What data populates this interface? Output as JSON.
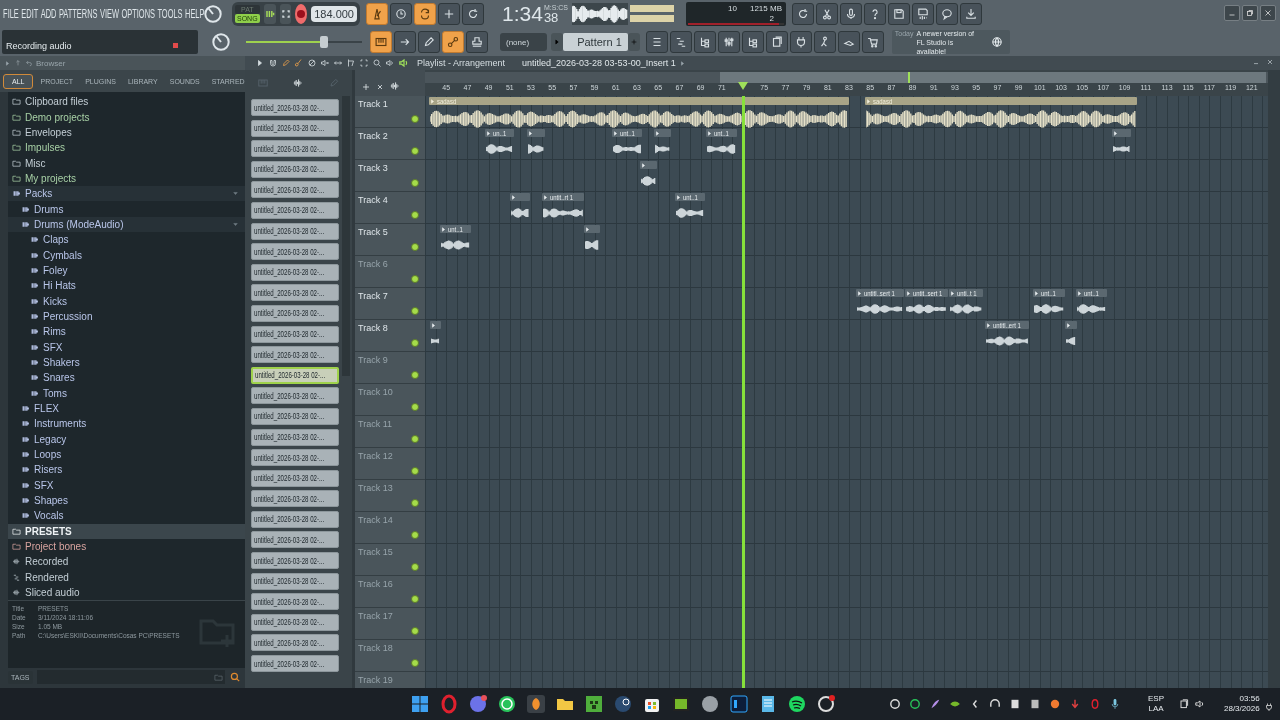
{
  "menu": [
    "FILE",
    "EDIT",
    "ADD",
    "PATTERNS",
    "VIEW",
    "OPTIONS",
    "TOOLS",
    "HELP"
  ],
  "hint": "Recording audio",
  "transport": {
    "modes": [
      {
        "label": "PAT",
        "selected": false
      },
      {
        "label": "SONG",
        "selected": true
      }
    ],
    "recording": true,
    "tempo": "184.000",
    "master": {
      "level": 0.67
    }
  },
  "toggles_top": [
    {
      "on": true
    },
    {
      "on": false
    },
    {
      "on": true
    },
    {
      "on": false
    },
    {
      "on": false
    }
  ],
  "toggles_bottom": [
    {
      "on": true
    },
    {
      "on": false
    },
    {
      "on": false
    },
    {
      "on": true
    },
    {
      "on": false
    }
  ],
  "time": {
    "value": "1:34",
    "centis": "38",
    "format": "M:S:CS"
  },
  "monitor": {
    "cpu": "10",
    "memory": "1215 MB",
    "polyphony": "2",
    "level": 0.95
  },
  "pattern": {
    "channel": "(none)",
    "name": "Pattern 1"
  },
  "news": {
    "date": "Today",
    "message": "A newer version of FL Studio is available!"
  },
  "browser": {
    "title": "Browser",
    "tabs": [
      {
        "label": "ALL",
        "selected": true
      },
      {
        "label": "PROJECT",
        "selected": false
      },
      {
        "label": "PLUGINS",
        "selected": false
      },
      {
        "label": "LIBRARY",
        "selected": false
      },
      {
        "label": "SOUNDS",
        "selected": false
      },
      {
        "label": "STARRED",
        "selected": false
      }
    ],
    "tree": [
      {
        "label": "Clipboard files",
        "kind": "builtin",
        "selected": false
      },
      {
        "label": "Demo projects",
        "kind": "user",
        "selected": false
      },
      {
        "label": "Envelopes",
        "kind": "builtin",
        "selected": false
      },
      {
        "label": "Impulses",
        "kind": "user",
        "selected": false
      },
      {
        "label": "Misc",
        "kind": "folder",
        "selected": false
      },
      {
        "label": "My projects",
        "kind": "user",
        "selected": false
      },
      {
        "label": "Packs",
        "kind": "pack",
        "selected": false,
        "expanded": true,
        "children": [
          {
            "label": "Drums",
            "kind": "pack",
            "selected": false
          },
          {
            "label": "Drums (ModeAudio)",
            "kind": "pack",
            "selected": false,
            "expanded": true,
            "children": [
              {
                "label": "Claps",
                "kind": "pack",
                "selected": false
              },
              {
                "label": "Cymbals",
                "kind": "pack",
                "selected": false
              },
              {
                "label": "Foley",
                "kind": "pack",
                "selected": false
              },
              {
                "label": "Hi Hats",
                "kind": "pack",
                "selected": false
              },
              {
                "label": "Kicks",
                "kind": "pack",
                "selected": false
              },
              {
                "label": "Percussion",
                "kind": "pack",
                "selected": false
              },
              {
                "label": "Rims",
                "kind": "pack",
                "selected": false
              },
              {
                "label": "SFX",
                "kind": "pack",
                "selected": false
              },
              {
                "label": "Shakers",
                "kind": "pack",
                "selected": false
              },
              {
                "label": "Snares",
                "kind": "pack",
                "selected": false
              },
              {
                "label": "Toms",
                "kind": "pack",
                "selected": false
              }
            ]
          },
          {
            "label": "FLEX",
            "kind": "pack",
            "selected": false
          },
          {
            "label": "Instruments",
            "kind": "pack",
            "selected": false
          },
          {
            "label": "Legacy",
            "kind": "pack",
            "selected": false
          },
          {
            "label": "Loops",
            "kind": "pack",
            "selected": false
          },
          {
            "label": "Risers",
            "kind": "pack",
            "selected": false
          },
          {
            "label": "SFX",
            "kind": "pack",
            "selected": false
          },
          {
            "label": "Shapes",
            "kind": "pack",
            "selected": false
          },
          {
            "label": "Vocals",
            "kind": "pack",
            "selected": false
          }
        ]
      },
      {
        "label": "PRESETS",
        "kind": "builtin",
        "selected": true
      },
      {
        "label": "Project bones",
        "kind": "template",
        "selected": false
      },
      {
        "label": "Recorded",
        "kind": "audio",
        "selected": false
      },
      {
        "label": "Rendered",
        "kind": "rendered",
        "selected": false
      },
      {
        "label": "Sliced audio",
        "kind": "audio",
        "selected": false
      }
    ],
    "info": [
      {
        "key": "Title",
        "value": "PRESETS"
      },
      {
        "key": "Date",
        "value": "3/11/2024 18:11:06"
      },
      {
        "key": "Size",
        "value": "1.05 MB"
      },
      {
        "key": "Path",
        "value": "C:\\Users\\ESKII\\Documents\\Cosas PC\\PRESETS"
      }
    ],
    "tags_label": "TAGS"
  },
  "playlist": {
    "title": "Playlist - Arrangement",
    "clip_source": "untitled_2026-03-28 03-53-00_Insert 1",
    "clip_list": [
      {
        "name": "untitled_2026-03-28 02-...",
        "selected": false
      },
      {
        "name": "untitled_2026-03-28 02-...",
        "selected": false
      },
      {
        "name": "untitled_2026-03-28 02-...",
        "selected": false
      },
      {
        "name": "untitled_2026-03-28 02-...",
        "selected": false
      },
      {
        "name": "untitled_2026-03-28 02-...",
        "selected": false
      },
      {
        "name": "untitled_2026-03-28 02-...",
        "selected": false
      },
      {
        "name": "untitled_2026-03-28 02-...",
        "selected": false
      },
      {
        "name": "untitled_2026-03-28 02-...",
        "selected": false
      },
      {
        "name": "untitled_2026-03-28 02-...",
        "selected": false
      },
      {
        "name": "untitled_2026-03-28 02-...",
        "selected": false
      },
      {
        "name": "untitled_2026-03-28 02-...",
        "selected": false
      },
      {
        "name": "untitled_2026-03-28 02-...",
        "selected": false
      },
      {
        "name": "untitled_2026-03-28 02-...",
        "selected": false
      },
      {
        "name": "untitled_2026-03-28 02-...",
        "selected": true
      },
      {
        "name": "untitled_2026-03-28 02-...",
        "selected": false
      },
      {
        "name": "untitled_2026-03-28 02-...",
        "selected": false
      },
      {
        "name": "untitled_2026-03-28 02-...",
        "selected": false
      },
      {
        "name": "untitled_2026-03-28 02-...",
        "selected": false
      },
      {
        "name": "untitled_2026-03-28 02-...",
        "selected": false
      },
      {
        "name": "untitled_2026-03-28 02-...",
        "selected": false
      },
      {
        "name": "untitled_2026-03-28 02-...",
        "selected": false
      },
      {
        "name": "untitled_2026-03-28 02-...",
        "selected": false
      },
      {
        "name": "untitled_2026-03-28 02-...",
        "selected": false
      },
      {
        "name": "untitled_2026-03-28 02-...",
        "selected": false
      },
      {
        "name": "untitled_2026-03-28 02-...",
        "selected": false
      },
      {
        "name": "untitled_2026-03-28 02-...",
        "selected": false
      },
      {
        "name": "untitled_2026-03-28 02-...",
        "selected": false
      },
      {
        "name": "untitled_2026-03-28 02-...",
        "selected": false
      }
    ],
    "ruler": [
      "45",
      "47",
      "49",
      "51",
      "53",
      "55",
      "57",
      "59",
      "61",
      "63",
      "65",
      "67",
      "69",
      "71",
      "75",
      "77",
      "79",
      "81",
      "83",
      "85",
      "87",
      "89",
      "91",
      "93",
      "95",
      "97",
      "99",
      "101",
      "103",
      "105",
      "107",
      "109",
      "111",
      "113",
      "115",
      "117",
      "119",
      "121"
    ],
    "tracks": [
      {
        "name": "Track 1",
        "dimmed": false,
        "clips": [
          {
            "label": "sadasd",
            "kind": "main"
          },
          {
            "label": "sadasd",
            "kind": "main"
          }
        ]
      },
      {
        "name": "Track 2",
        "dimmed": false,
        "clips": [
          {
            "label": "un..1",
            "kind": "take"
          },
          {
            "kind": "take"
          },
          {
            "label": "unt..1",
            "kind": "take"
          },
          {
            "kind": "take"
          },
          {
            "label": "unt..1",
            "kind": "take"
          },
          {
            "kind": "take"
          }
        ]
      },
      {
        "name": "Track 3",
        "dimmed": false,
        "clips": [
          {
            "kind": "take"
          }
        ]
      },
      {
        "name": "Track 4",
        "dimmed": false,
        "clips": [
          {
            "kind": "take"
          },
          {
            "label": "untit..rt 1",
            "kind": "take"
          },
          {
            "label": "unt..1",
            "kind": "take"
          }
        ]
      },
      {
        "name": "Track 5",
        "dimmed": false,
        "clips": [
          {
            "label": "unt..1",
            "kind": "take"
          },
          {
            "kind": "take"
          }
        ]
      },
      {
        "name": "Track 6",
        "dimmed": true
      },
      {
        "name": "Track 7",
        "dimmed": false,
        "clips": [
          {
            "label": "untitl..sert 1",
            "kind": "take"
          },
          {
            "label": "untit..sert 1",
            "kind": "take"
          },
          {
            "label": "unti..t 1",
            "kind": "take"
          },
          {
            "label": "unt..1",
            "kind": "take"
          },
          {
            "label": "unt..1",
            "kind": "take"
          }
        ]
      },
      {
        "name": "Track 8",
        "dimmed": false,
        "clips": [
          {
            "kind": "take"
          },
          {
            "label": "untitl..ert 1",
            "kind": "take"
          },
          {
            "kind": "take"
          }
        ]
      },
      {
        "name": "Track 9",
        "dimmed": true
      },
      {
        "name": "Track 10",
        "dimmed": true
      },
      {
        "name": "Track 11",
        "dimmed": true
      },
      {
        "name": "Track 12",
        "dimmed": true
      },
      {
        "name": "Track 13",
        "dimmed": true
      },
      {
        "name": "Track 14",
        "dimmed": true
      },
      {
        "name": "Track 15",
        "dimmed": true
      },
      {
        "name": "Track 16",
        "dimmed": true
      },
      {
        "name": "Track 17",
        "dimmed": true
      },
      {
        "name": "Track 18",
        "dimmed": true
      },
      {
        "name": "Track 19",
        "dimmed": true
      }
    ]
  },
  "taskbar": {
    "language": "ESP",
    "layout": "LAA",
    "time": "03:56",
    "date": "28/3/2026"
  }
}
